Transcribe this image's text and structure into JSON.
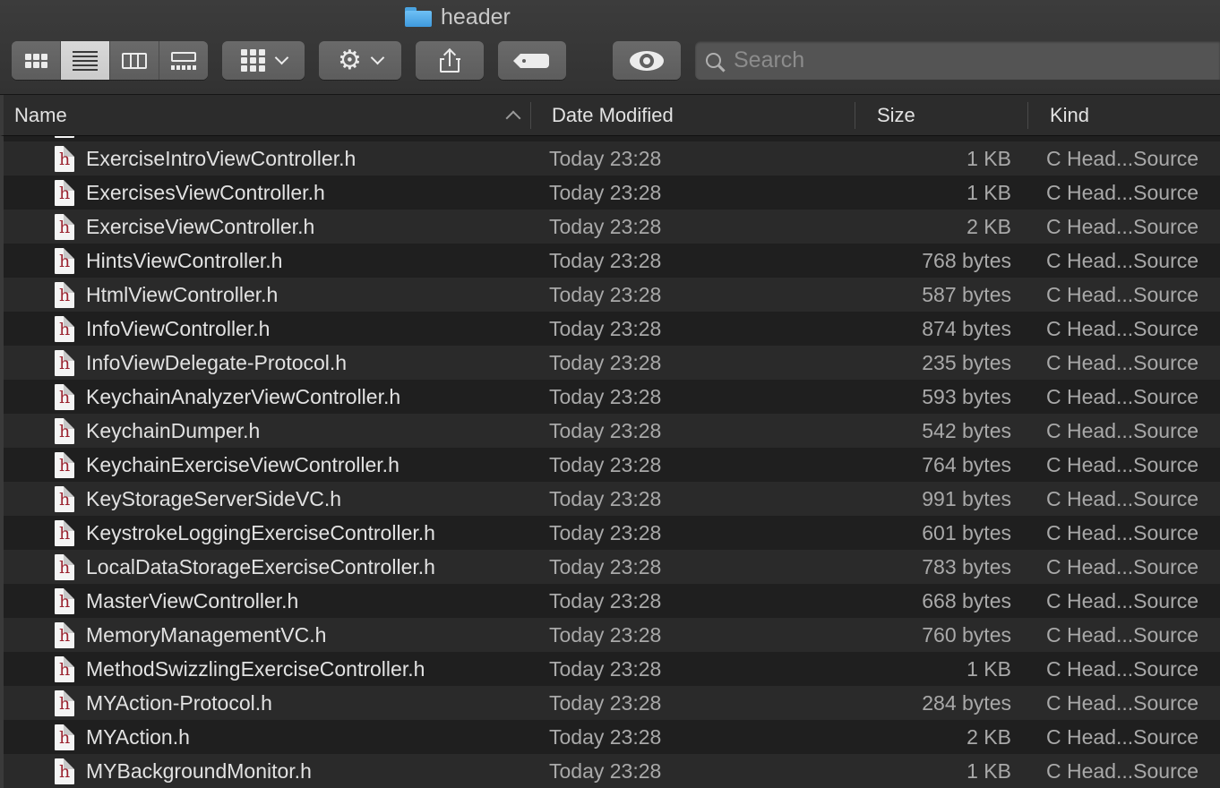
{
  "window": {
    "title": "header",
    "title_icon": "folder-icon"
  },
  "toolbar": {
    "view_modes": [
      {
        "name": "icon-view",
        "icon": "grid-icon",
        "active": false
      },
      {
        "name": "list-view",
        "icon": "list-icon",
        "active": true
      },
      {
        "name": "column-view",
        "icon": "columns-icon",
        "active": false
      },
      {
        "name": "gallery-view",
        "icon": "gallery-icon",
        "active": false
      }
    ],
    "group_button_icon": "group-grid-icon",
    "action_button_icon": "gear-icon",
    "share_button_icon": "share-icon",
    "tag_button_icon": "tag-icon",
    "quicklook_button_icon": "eye-icon",
    "search": {
      "placeholder": "Search",
      "value": ""
    }
  },
  "columns": {
    "name": "Name",
    "date": "Date Modified",
    "size": "Size",
    "kind": "Kind",
    "sort_column": "name",
    "sort_direction": "ascending"
  },
  "files": [
    {
      "name": "ExerciseIntroViewController.h",
      "date": "Today 23:28",
      "size": "1 KB",
      "kind": "C Head...Source"
    },
    {
      "name": "ExercisesViewController.h",
      "date": "Today 23:28",
      "size": "1 KB",
      "kind": "C Head...Source"
    },
    {
      "name": "ExerciseViewController.h",
      "date": "Today 23:28",
      "size": "2 KB",
      "kind": "C Head...Source"
    },
    {
      "name": "HintsViewController.h",
      "date": "Today 23:28",
      "size": "768 bytes",
      "kind": "C Head...Source"
    },
    {
      "name": "HtmlViewController.h",
      "date": "Today 23:28",
      "size": "587 bytes",
      "kind": "C Head...Source"
    },
    {
      "name": "InfoViewController.h",
      "date": "Today 23:28",
      "size": "874 bytes",
      "kind": "C Head...Source"
    },
    {
      "name": "InfoViewDelegate-Protocol.h",
      "date": "Today 23:28",
      "size": "235 bytes",
      "kind": "C Head...Source"
    },
    {
      "name": "KeychainAnalyzerViewController.h",
      "date": "Today 23:28",
      "size": "593 bytes",
      "kind": "C Head...Source"
    },
    {
      "name": "KeychainDumper.h",
      "date": "Today 23:28",
      "size": "542 bytes",
      "kind": "C Head...Source"
    },
    {
      "name": "KeychainExerciseViewController.h",
      "date": "Today 23:28",
      "size": "764 bytes",
      "kind": "C Head...Source"
    },
    {
      "name": "KeyStorageServerSideVC.h",
      "date": "Today 23:28",
      "size": "991 bytes",
      "kind": "C Head...Source"
    },
    {
      "name": "KeystrokeLoggingExerciseController.h",
      "date": "Today 23:28",
      "size": "601 bytes",
      "kind": "C Head...Source"
    },
    {
      "name": "LocalDataStorageExerciseController.h",
      "date": "Today 23:28",
      "size": "783 bytes",
      "kind": "C Head...Source"
    },
    {
      "name": "MasterViewController.h",
      "date": "Today 23:28",
      "size": "668 bytes",
      "kind": "C Head...Source"
    },
    {
      "name": "MemoryManagementVC.h",
      "date": "Today 23:28",
      "size": "760 bytes",
      "kind": "C Head...Source"
    },
    {
      "name": "MethodSwizzlingExerciseController.h",
      "date": "Today 23:28",
      "size": "1 KB",
      "kind": "C Head...Source"
    },
    {
      "name": "MYAction-Protocol.h",
      "date": "Today 23:28",
      "size": "284 bytes",
      "kind": "C Head...Source"
    },
    {
      "name": "MYAction.h",
      "date": "Today 23:28",
      "size": "2 KB",
      "kind": "C Head...Source"
    },
    {
      "name": "MYBackgroundMonitor.h",
      "date": "Today 23:28",
      "size": "1 KB",
      "kind": "C Head...Source"
    }
  ],
  "file_icon_letter": "h",
  "colors": {
    "background": "#1e1e1e",
    "row_alt": "#2a2a2a",
    "toolbar": "#3a3a3a",
    "folder_blue": "#4aa3e0",
    "header_file_letter": "#9b2430"
  }
}
